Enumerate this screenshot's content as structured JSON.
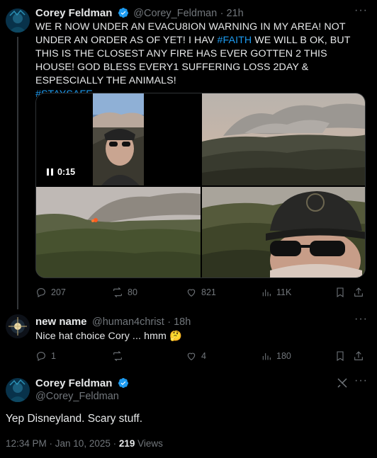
{
  "tweet1": {
    "author": "Corey Feldman",
    "handle": "@Corey_Feldman",
    "time": "21h",
    "text_main": "WE R NOW UNDER AN EVACU8ION WARNING IN MY AREA! NOT UNDER AN ORDER AS OF YET! I HAV ",
    "hashtag1": "#FAITH",
    "text_rest": " WE WILL B OK, BUT THIS IS THE CLOSEST ANY FIRE HAS EVER GOTTEN 2 THIS HOUSE! GOD BLESS EVERY1 SUFFERING LOSS 2DAY & ESPESCIALLY THE ANIMALS!",
    "hashtag2": "#STAYSAFE",
    "video_duration": "0:15",
    "replies": "207",
    "reposts": "80",
    "likes": "821",
    "views": "11K"
  },
  "tweet2": {
    "author": "new name",
    "handle": "@human4christ",
    "time": "18h",
    "text": "Nice hat choice Cory ... hmm",
    "emoji": "🤔",
    "replies": "1",
    "reposts": "",
    "likes": "4",
    "views": "180"
  },
  "tweet3": {
    "author": "Corey Feldman",
    "handle": "@Corey_Feldman",
    "text": "Yep Disneyland. Scary stuff.",
    "timestamp": "12:34 PM · Jan 10, 2025 · ",
    "view_count": "219",
    "views_label": " Views"
  },
  "colors": {
    "background": "#000000",
    "text": "#e7e9ea",
    "muted": "#71767b",
    "link": "#1d9bf0",
    "verified": "#1d9bf0",
    "divider": "#2f3336"
  }
}
